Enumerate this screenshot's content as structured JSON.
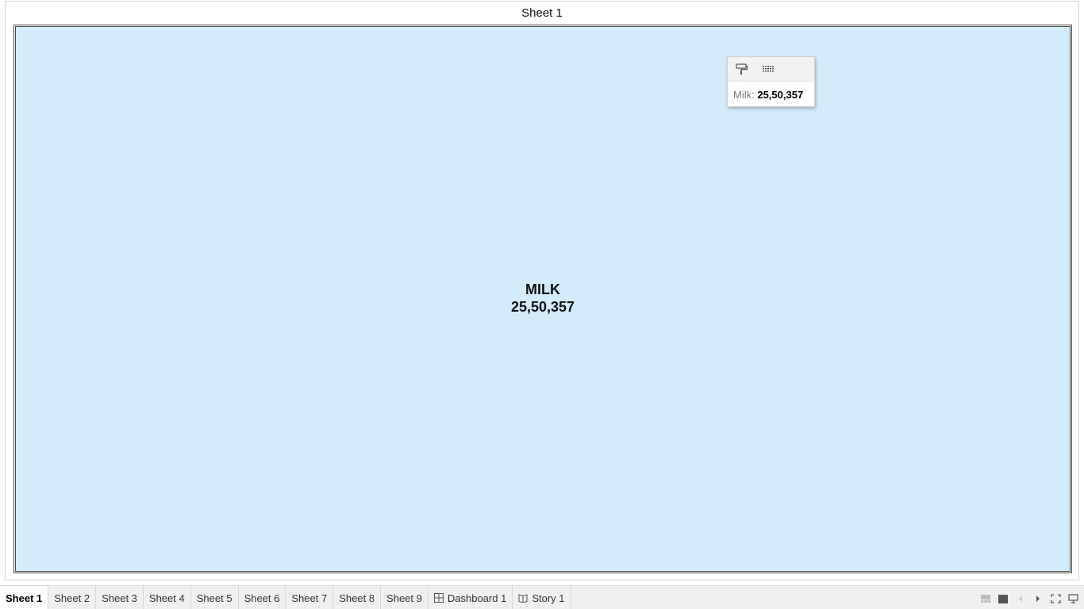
{
  "sheet": {
    "title": "Sheet 1"
  },
  "chart_data": {
    "type": "treemap",
    "marks": [
      {
        "category": "MILK",
        "value": 2550357,
        "value_label": "25,50,357",
        "color": "#d2ecfb"
      }
    ]
  },
  "tooltip": {
    "label": "Milk:",
    "value": "25,50,357",
    "icons": [
      "format-painter-icon",
      "view-data-icon"
    ]
  },
  "tabs": [
    {
      "label": "Sheet 1",
      "active": true,
      "icon": null
    },
    {
      "label": "Sheet 2",
      "active": false,
      "icon": null
    },
    {
      "label": "Sheet 3",
      "active": false,
      "icon": null
    },
    {
      "label": "Sheet 4",
      "active": false,
      "icon": null
    },
    {
      "label": "Sheet 5",
      "active": false,
      "icon": null
    },
    {
      "label": "Sheet 6",
      "active": false,
      "icon": null
    },
    {
      "label": "Sheet 7",
      "active": false,
      "icon": null
    },
    {
      "label": "Sheet 8",
      "active": false,
      "icon": null
    },
    {
      "label": "Sheet 9",
      "active": false,
      "icon": null
    },
    {
      "label": "Dashboard 1",
      "active": false,
      "icon": "dashboard-icon"
    },
    {
      "label": "Story 1",
      "active": false,
      "icon": "story-icon"
    }
  ],
  "view_controls": [
    "filmstrip-view-icon",
    "tabs-view-icon",
    "previous-icon",
    "next-icon",
    "fullscreen-icon",
    "presentation-mode-icon"
  ],
  "colors": {
    "treemap_fill": "#d2ecfb",
    "tab_bar_bg": "#f0f0f0"
  }
}
